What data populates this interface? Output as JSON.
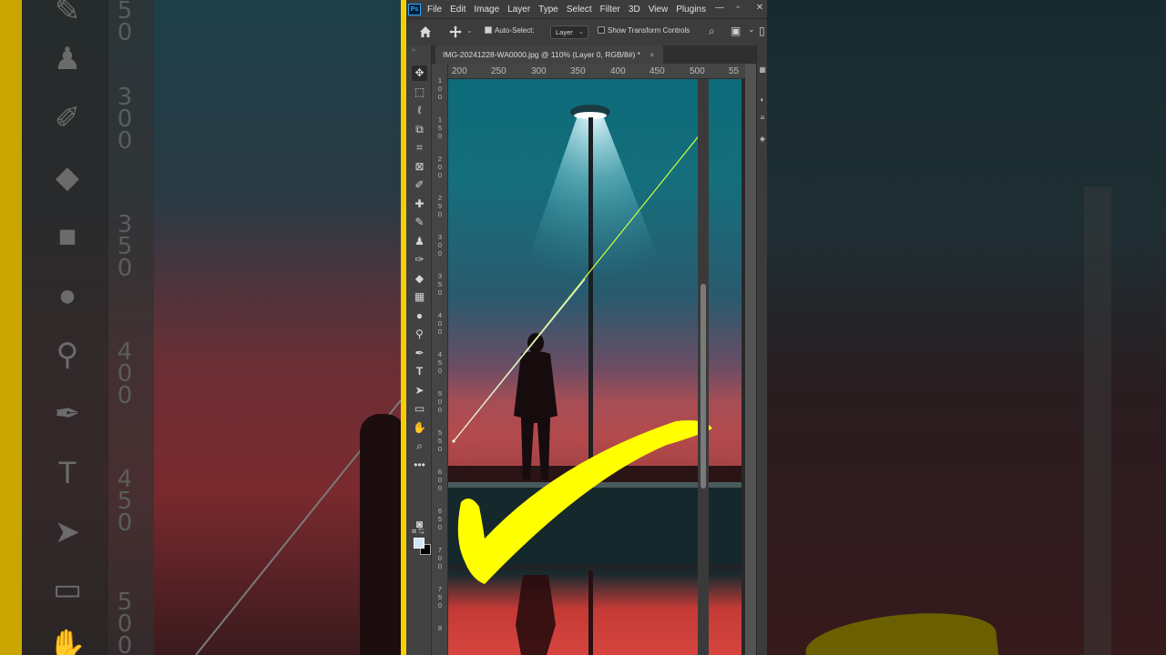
{
  "app": {
    "name": "Photoshop",
    "logo_text": "Ps",
    "menu": [
      "File",
      "Edit",
      "Image",
      "Layer",
      "Type",
      "Select",
      "Filter",
      "3D",
      "View",
      "Plugins"
    ]
  },
  "options_bar": {
    "auto_select_label": "Auto-Select:",
    "auto_select_checked": true,
    "auto_select_target": "Layer",
    "show_transform_label": "Show Transform Controls",
    "show_transform_checked": false
  },
  "document": {
    "tab_title": "IMG-20241228-WA0000.jpg @ 110% (Layer 0, RGB/8#) *",
    "close_glyph": "×"
  },
  "rulers": {
    "horizontal": [
      "200",
      "250",
      "300",
      "350",
      "400",
      "450",
      "500",
      "55"
    ],
    "vertical": [
      "100",
      "150",
      "200",
      "250",
      "300",
      "350",
      "400",
      "450",
      "500",
      "550",
      "600",
      "650",
      "700",
      "750",
      "8"
    ]
  },
  "tools": [
    "move-tool",
    "marquee-tool",
    "lasso-tool",
    "object-select-tool",
    "crop-tool",
    "frame-tool",
    "eyedropper-tool",
    "healing-brush-tool",
    "brush-tool",
    "clone-stamp-tool",
    "history-brush-tool",
    "eraser-tool",
    "gradient-tool",
    "blur-tool",
    "dodge-tool",
    "pen-tool",
    "type-tool",
    "path-selection-tool",
    "rectangle-tool",
    "hand-tool",
    "zoom-tool",
    "edit-toolbar"
  ],
  "colors": {
    "foreground": "#cfe6f5",
    "background": "#000000",
    "highlight_border": "#f5d000",
    "checkmark": "#ffff00",
    "guide_line": "#c8ff3c"
  }
}
